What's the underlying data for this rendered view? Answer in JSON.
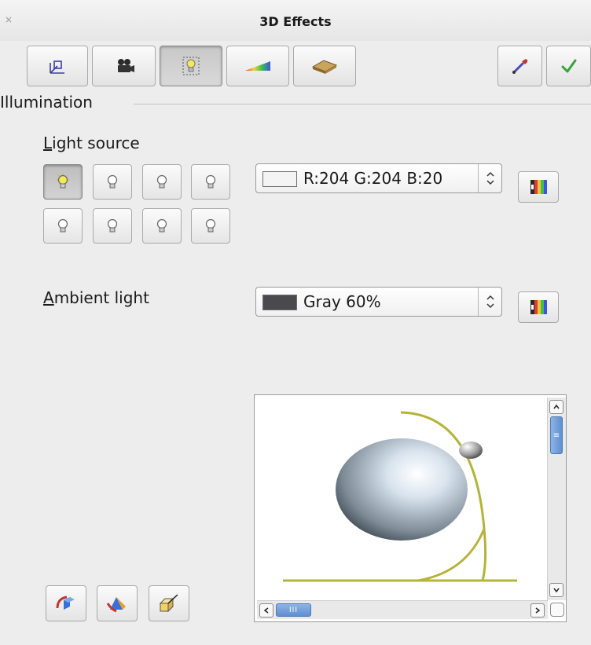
{
  "window": {
    "title": "3D Effects",
    "close_glyph": "×"
  },
  "toolbar": {
    "tabs": [
      {
        "name": "geometry",
        "icon": "geometry-icon"
      },
      {
        "name": "shading",
        "icon": "camera-icon"
      },
      {
        "name": "illumination",
        "icon": "bulb-icon",
        "active": true
      },
      {
        "name": "textures",
        "icon": "texture-icon"
      },
      {
        "name": "material",
        "icon": "material-icon"
      }
    ],
    "actions": [
      {
        "name": "assign",
        "icon": "pipette-icon"
      },
      {
        "name": "apply",
        "icon": "checkmark-icon"
      }
    ]
  },
  "illumination": {
    "heading": "Illumination",
    "light_source": {
      "label_accel": "L",
      "label_rest": "ight source",
      "lights": [
        {
          "on": true
        },
        {
          "on": false
        },
        {
          "on": false
        },
        {
          "on": false
        },
        {
          "on": false
        },
        {
          "on": false
        },
        {
          "on": false
        },
        {
          "on": false
        }
      ],
      "color_value": "R:204 G:204 B:20",
      "color_swatch": "#f4f4f4"
    },
    "ambient": {
      "label_accel": "A",
      "label_rest": "mbient light",
      "color_value": "Gray 60%",
      "color_swatch": "#4a4a4e"
    }
  },
  "colors": {
    "accent": "#6fa0d6",
    "guide_line": "#b5b33a"
  },
  "scroll": {
    "h_thumb_glyph": "III",
    "v_thumb_glyph": "≡"
  },
  "bottom_buttons": [
    {
      "name": "convert-to-rotation",
      "icon": "rotation-icon"
    },
    {
      "name": "perspective",
      "icon": "perspective-icon"
    },
    {
      "name": "convert-to-3d",
      "icon": "convert-3d-icon"
    }
  ]
}
